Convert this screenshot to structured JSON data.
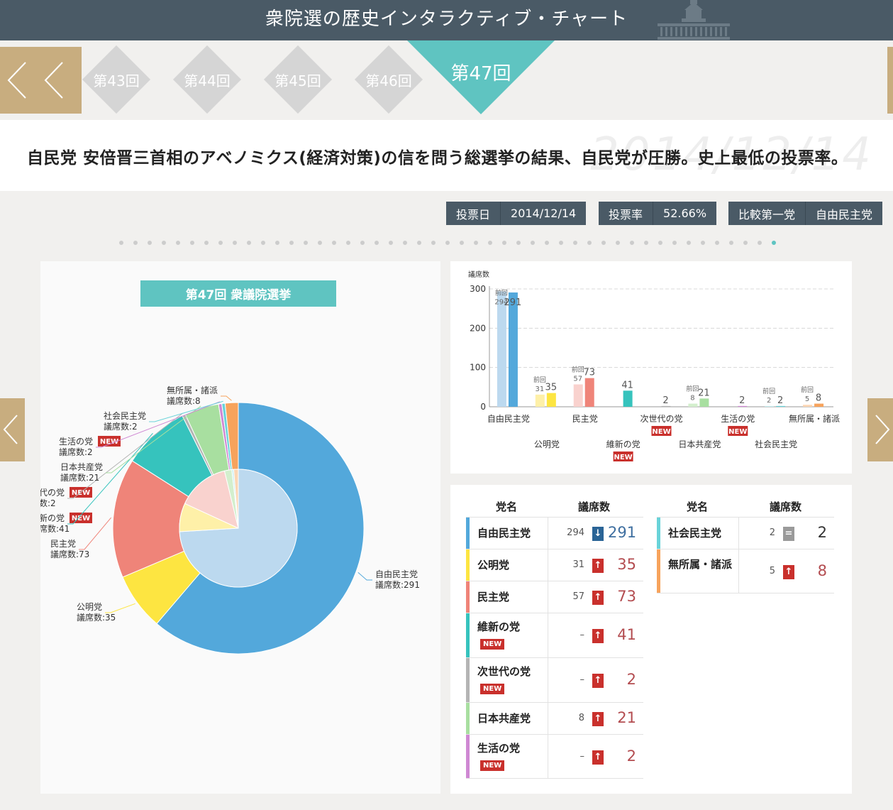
{
  "header": {
    "title": "衆院選の歴史インタラクティブ・チャート"
  },
  "rounds": {
    "items": [
      "第43回",
      "第44回",
      "第45回",
      "第46回"
    ],
    "active": "第47回"
  },
  "headline": {
    "text": "自民党 安倍晋三首相のアベノミクス(経済対策)の信を問う総選挙の結果、自民党が圧勝。史上最低の投票率。",
    "bg_date": "2014/12/14"
  },
  "info": {
    "vote_day_label": "投票日",
    "vote_day": "2014/12/14",
    "turnout_label": "投票率",
    "turnout": "52.66%",
    "first_label": "比較第一党",
    "first": "自由民主党"
  },
  "donut": {
    "title": "第47回 衆議院選挙",
    "seat_prefix": "議席数:"
  },
  "new_badge": "NEW",
  "chart_data": [
    {
      "type": "pie",
      "title": "第47回 衆議院選挙",
      "inner_values": [
        294,
        31,
        57,
        0,
        0,
        8,
        0,
        2,
        5
      ],
      "categories": [
        "自由民主党",
        "公明党",
        "民主党",
        "維新の党",
        "次世代の党",
        "日本共産党",
        "生活の党",
        "社会民主党",
        "無所属・諸派"
      ],
      "values": [
        291,
        35,
        73,
        41,
        2,
        21,
        2,
        2,
        8
      ],
      "colors": [
        "#53a8db",
        "#fde541",
        "#ef8479",
        "#36c3bd",
        "#b4b4b4",
        "#a8dfa0",
        "#cf88d3",
        "#69d3d9",
        "#f7a35c"
      ],
      "inner_colors": [
        "#bcd9ef",
        "#fef0a8",
        "#f9d2ce",
        "#aee8e4",
        "#dddddd",
        "#d3efcd",
        "#ebcaec",
        "#c6eef0",
        "#fbd6b4"
      ],
      "labels": [
        {
          "name": "自由民主党",
          "value": "291"
        },
        {
          "name": "公明党",
          "value": "35"
        },
        {
          "name": "民主党",
          "value": "73"
        },
        {
          "name": "維新の党",
          "value": "41",
          "shown": "新の党",
          "shown_value": "席数:41",
          "is_new": true
        },
        {
          "name": "次世代の党",
          "value": "2",
          "shown": "代の党",
          "shown_value": "数:2",
          "is_new": true
        },
        {
          "name": "日本共産党",
          "value": "21"
        },
        {
          "name": "生活の党",
          "value": "2",
          "is_new": true
        },
        {
          "name": "社会民主党",
          "value": "2"
        },
        {
          "name": "無所属・諸派",
          "value": "8"
        }
      ]
    },
    {
      "type": "bar",
      "ylabel": "議席数",
      "ylim": [
        0,
        300
      ],
      "yticks": [
        0,
        100,
        200,
        300
      ],
      "categories": [
        "自由民主党",
        "公明党",
        "民主党",
        "維新の党",
        "次世代の党",
        "日本共産党",
        "生活の党",
        "社会民主党",
        "無所属・諸派"
      ],
      "is_new": [
        false,
        false,
        false,
        true,
        true,
        false,
        true,
        false,
        false
      ],
      "series": [
        {
          "name": "前回",
          "values": [
            294,
            31,
            57,
            null,
            null,
            8,
            null,
            2,
            5
          ]
        },
        {
          "values": [
            291,
            35,
            73,
            41,
            2,
            21,
            2,
            2,
            8
          ]
        }
      ]
    }
  ],
  "table": {
    "col_party": "党名",
    "col_seats": "議席数",
    "rows": [
      {
        "name": "自由民主党",
        "prev": "294",
        "change": "down",
        "seats": "291",
        "color": "#53a8db",
        "is_new": false
      },
      {
        "name": "公明党",
        "prev": "31",
        "change": "up",
        "seats": "35",
        "color": "#fde541",
        "is_new": false
      },
      {
        "name": "民主党",
        "prev": "57",
        "change": "up",
        "seats": "73",
        "color": "#ef8479",
        "is_new": false
      },
      {
        "name": "維新の党",
        "prev": "–",
        "change": "up",
        "seats": "41",
        "color": "#36c3bd",
        "is_new": true
      },
      {
        "name": "次世代の党",
        "prev": "–",
        "change": "up",
        "seats": "2",
        "color": "#b4b4b4",
        "is_new": true
      },
      {
        "name": "日本共産党",
        "prev": "8",
        "change": "up",
        "seats": "21",
        "color": "#a8dfa0",
        "is_new": false
      },
      {
        "name": "生活の党",
        "prev": "–",
        "change": "up",
        "seats": "2",
        "color": "#cf88d3",
        "is_new": true
      }
    ],
    "rows2": [
      {
        "name": "社会民主党",
        "prev": "2",
        "change": "same",
        "seats": "2",
        "color": "#69d3d9",
        "is_new": false
      },
      {
        "name": "無所属・諸派",
        "prev": "5",
        "change": "up",
        "seats": "8",
        "color": "#f7a35c",
        "is_new": false
      }
    ]
  }
}
